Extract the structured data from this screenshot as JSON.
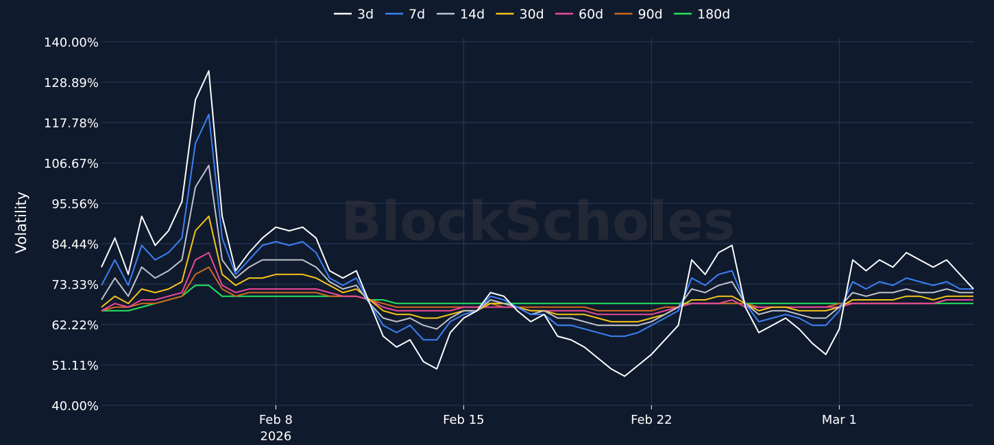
{
  "chart_data": {
    "type": "line",
    "ylabel": "Volatility",
    "watermark": "BlockScholes",
    "y_ticks": [
      "140.00%",
      "128.89%",
      "117.78%",
      "106.67%",
      "95.56%",
      "84.44%",
      "73.33%",
      "62.22%",
      "51.11%",
      "40.00%"
    ],
    "ylim": [
      40,
      140
    ],
    "xlim": [
      "2026-02-01T12:00",
      "2026-03-06T00:00"
    ],
    "x_ticks": [
      {
        "date": "2026-02-08",
        "label": "Feb 8",
        "sublabel": "2026"
      },
      {
        "date": "2026-02-15",
        "label": "Feb 15",
        "sublabel": ""
      },
      {
        "date": "2026-02-22",
        "label": "Feb 22",
        "sublabel": ""
      },
      {
        "date": "2026-03-01",
        "label": "Mar 1",
        "sublabel": ""
      }
    ],
    "grid": true,
    "legend_position": "top-center",
    "x": [
      "2026-02-01T12:00",
      "2026-02-02T00:00",
      "2026-02-02T12:00",
      "2026-02-03T00:00",
      "2026-02-03T12:00",
      "2026-02-04T00:00",
      "2026-02-04T12:00",
      "2026-02-05T00:00",
      "2026-02-05T12:00",
      "2026-02-06T00:00",
      "2026-02-06T12:00",
      "2026-02-07T00:00",
      "2026-02-07T12:00",
      "2026-02-08T00:00",
      "2026-02-08T12:00",
      "2026-02-09T00:00",
      "2026-02-09T12:00",
      "2026-02-10T00:00",
      "2026-02-10T12:00",
      "2026-02-11T00:00",
      "2026-02-11T12:00",
      "2026-02-12T00:00",
      "2026-02-12T12:00",
      "2026-02-13T00:00",
      "2026-02-13T12:00",
      "2026-02-14T00:00",
      "2026-02-14T12:00",
      "2026-02-15T00:00",
      "2026-02-15T12:00",
      "2026-02-16T00:00",
      "2026-02-16T12:00",
      "2026-02-17T00:00",
      "2026-02-17T12:00",
      "2026-02-18T00:00",
      "2026-02-18T12:00",
      "2026-02-19T00:00",
      "2026-02-19T12:00",
      "2026-02-20T00:00",
      "2026-02-20T12:00",
      "2026-02-21T00:00",
      "2026-02-21T12:00",
      "2026-02-22T00:00",
      "2026-02-22T12:00",
      "2026-02-23T00:00",
      "2026-02-23T12:00",
      "2026-02-24T00:00",
      "2026-02-24T12:00",
      "2026-02-25T00:00",
      "2026-02-25T12:00",
      "2026-02-26T00:00",
      "2026-02-26T12:00",
      "2026-02-27T00:00",
      "2026-02-27T12:00",
      "2026-02-28T00:00",
      "2026-02-28T12:00",
      "2026-03-01T00:00",
      "2026-03-01T12:00",
      "2026-03-02T00:00",
      "2026-03-02T12:00",
      "2026-03-03T00:00",
      "2026-03-03T12:00",
      "2026-03-04T00:00",
      "2026-03-04T12:00",
      "2026-03-05T00:00",
      "2026-03-05T12:00",
      "2026-03-06T00:00"
    ],
    "series": [
      {
        "name": "3d",
        "color": "#ffffff",
        "values": [
          78,
          86,
          76,
          92,
          84,
          88,
          96,
          124,
          132,
          92,
          77,
          82,
          86,
          89,
          88,
          89,
          86,
          77,
          75,
          77,
          68,
          59,
          56,
          58,
          52,
          50,
          60,
          64,
          66,
          71,
          70,
          66,
          63,
          65,
          59,
          58,
          56,
          53,
          50,
          48,
          51,
          54,
          58,
          62,
          80,
          76,
          82,
          84,
          67,
          60,
          62,
          64,
          61,
          57,
          54,
          61,
          80,
          77,
          80,
          78,
          82,
          80,
          78,
          80,
          76,
          72
        ]
      },
      {
        "name": "7d",
        "color": "#3b82f6",
        "values": [
          73,
          80,
          73,
          84,
          80,
          82,
          86,
          112,
          120,
          86,
          76,
          80,
          84,
          85,
          84,
          85,
          82,
          75,
          73,
          75,
          68,
          62,
          60,
          62,
          58,
          58,
          63,
          65,
          66,
          70,
          69,
          67,
          65,
          65,
          62,
          62,
          61,
          60,
          59,
          59,
          60,
          62,
          64,
          66,
          75,
          73,
          76,
          77,
          68,
          63,
          64,
          65,
          64,
          62,
          62,
          66,
          74,
          72,
          74,
          73,
          75,
          74,
          73,
          74,
          72,
          72
        ]
      },
      {
        "name": "14d",
        "color": "#c0c4cc",
        "values": [
          69,
          75,
          70,
          78,
          75,
          77,
          80,
          100,
          106,
          80,
          75,
          78,
          80,
          80,
          80,
          80,
          78,
          74,
          72,
          73,
          68,
          64,
          63,
          64,
          62,
          61,
          64,
          66,
          66,
          69,
          68,
          67,
          65,
          66,
          64,
          64,
          63,
          62,
          62,
          62,
          62,
          63,
          65,
          67,
          72,
          71,
          73,
          74,
          68,
          65,
          66,
          66,
          65,
          64,
          64,
          67,
          71,
          70,
          71,
          71,
          72,
          71,
          71,
          72,
          71,
          71
        ]
      },
      {
        "name": "30d",
        "color": "#f5c518",
        "values": [
          67,
          70,
          68,
          72,
          71,
          72,
          74,
          88,
          92,
          76,
          73,
          75,
          75,
          76,
          76,
          76,
          75,
          73,
          71,
          72,
          69,
          66,
          65,
          65,
          64,
          64,
          65,
          66,
          66,
          68,
          68,
          67,
          66,
          66,
          65,
          65,
          65,
          64,
          63,
          63,
          63,
          64,
          65,
          67,
          69,
          69,
          70,
          70,
          68,
          66,
          67,
          67,
          66,
          66,
          66,
          67,
          69,
          69,
          69,
          69,
          70,
          70,
          69,
          70,
          70,
          70
        ]
      },
      {
        "name": "60d",
        "color": "#ec4899",
        "values": [
          66,
          68,
          67,
          69,
          69,
          70,
          71,
          80,
          82,
          73,
          71,
          72,
          72,
          72,
          72,
          72,
          72,
          71,
          70,
          70,
          69,
          67,
          66,
          66,
          66,
          66,
          66,
          67,
          67,
          67,
          67,
          67,
          66,
          66,
          66,
          66,
          66,
          65,
          65,
          65,
          65,
          65,
          66,
          67,
          68,
          68,
          68,
          69,
          67,
          67,
          67,
          67,
          67,
          67,
          67,
          67,
          68,
          68,
          68,
          68,
          68,
          68,
          68,
          69,
          69,
          69
        ]
      },
      {
        "name": "90d",
        "color": "#d2691e",
        "values": [
          66,
          67,
          67,
          68,
          68,
          69,
          70,
          76,
          78,
          72,
          70,
          71,
          71,
          71,
          71,
          71,
          71,
          70,
          70,
          70,
          69,
          68,
          67,
          67,
          67,
          67,
          67,
          67,
          67,
          68,
          67,
          67,
          67,
          67,
          67,
          67,
          67,
          66,
          66,
          66,
          66,
          66,
          67,
          67,
          68,
          68,
          68,
          68,
          68,
          67,
          67,
          67,
          67,
          67,
          67,
          68,
          68,
          68,
          68,
          68,
          68,
          68,
          68,
          69,
          69,
          69
        ]
      },
      {
        "name": "180d",
        "color": "#22e55e",
        "values": [
          66,
          66,
          66,
          67,
          68,
          69,
          70,
          73,
          73,
          70,
          70,
          70,
          70,
          70,
          70,
          70,
          70,
          70,
          70,
          70,
          69,
          69,
          68,
          68,
          68,
          68,
          68,
          68,
          68,
          68,
          68,
          68,
          68,
          68,
          68,
          68,
          68,
          68,
          68,
          68,
          68,
          68,
          68,
          68,
          68,
          68,
          68,
          68,
          68,
          68,
          68,
          68,
          68,
          68,
          68,
          68,
          68,
          68,
          68,
          68,
          68,
          68,
          68,
          68,
          68,
          68
        ]
      }
    ]
  }
}
